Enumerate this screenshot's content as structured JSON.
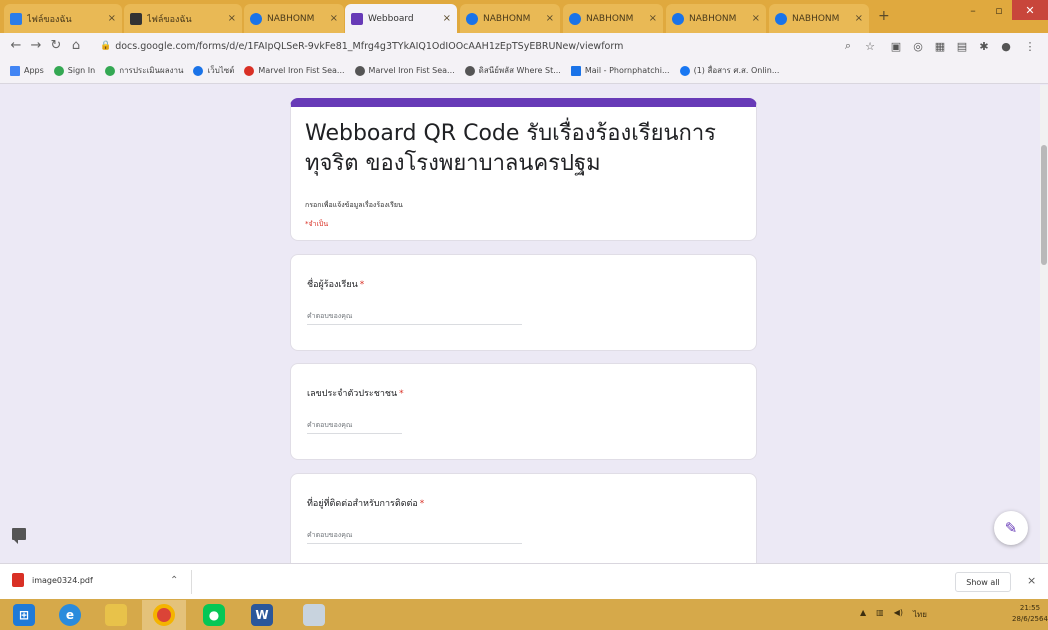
{
  "browser": {
    "tabs": [
      {
        "title": "ไฟล์ของฉัน",
        "favicon_color": "#2b7de9",
        "active": false
      },
      {
        "title": "ไฟล์ของฉัน",
        "favicon_color": "#333333",
        "active": false
      },
      {
        "title": "NABHONM",
        "favicon_color": "#1a73e8",
        "active": false
      },
      {
        "title": "Webboard",
        "favicon_color": "#673ab7",
        "active": true
      },
      {
        "title": "NABHONM",
        "favicon_color": "#1a73e8",
        "active": false
      },
      {
        "title": "NABHONM",
        "favicon_color": "#1a73e8",
        "active": false
      },
      {
        "title": "NABHONM",
        "favicon_color": "#1a73e8",
        "active": false
      },
      {
        "title": "NABHONM",
        "favicon_color": "#1a73e8",
        "active": false
      }
    ],
    "new_tab": "+",
    "url": "docs.google.com/forms/d/e/1FAIpQLSeR-9vkFe81_Mfrg4g3TYkAIQ1OdIOOcAAH1zEpTSyEBRUNew/viewform",
    "bookmarks": [
      {
        "label": "Apps",
        "color": "#4285f4"
      },
      {
        "label": "Sign In",
        "color": "#34a853"
      },
      {
        "label": "การประเมินผลงาน",
        "color": "#34a853"
      },
      {
        "label": "เว็บไซต์",
        "color": "#1a73e8"
      },
      {
        "label": "Marvel Iron Fist Sea...",
        "color": "#d93025"
      },
      {
        "label": "Marvel Iron Fist Sea...",
        "color": "#555555"
      },
      {
        "label": "ดิสนีย์พลัส Where St...",
        "color": "#555555"
      },
      {
        "label": "Mail - Phornphatchi...",
        "color": "#1a73e8"
      },
      {
        "label": "(1) สื่อสาร ศ.ส. Onlin...",
        "color": "#1877f2"
      }
    ]
  },
  "form": {
    "title": "Webboard QR Code รับเรื่องร้องเรียนการทุจริต ของโรงพยาบาลนครปฐม",
    "description": "กรอกเพื่อแจ้งข้อมูลเรื่องร้องเรียน",
    "required_note": "*จำเป็น",
    "accent_color": "#673ab7",
    "questions": [
      {
        "label": "ชื่อผู้ร้องเรียน",
        "required_mark": "*",
        "placeholder": "คำตอบของคุณ"
      },
      {
        "label": "เลขประจำตัวประชาชน",
        "required_mark": "*",
        "placeholder": "คำตอบของคุณ"
      },
      {
        "label": "ที่อยู่ที่ติดต่อสำหรับการติดต่อ",
        "required_mark": "*",
        "placeholder": "คำตอบของคุณ"
      }
    ]
  },
  "downloads": {
    "file_name": "image0324.pdf",
    "show_all": "Show all",
    "close": "×"
  },
  "taskbar": {
    "apps": [
      "start",
      "internet-explorer",
      "file-explorer",
      "chrome",
      "line",
      "word",
      "paint"
    ],
    "clock_time": "21:55",
    "clock_date": "28/6/2564",
    "language": "ไทย"
  }
}
